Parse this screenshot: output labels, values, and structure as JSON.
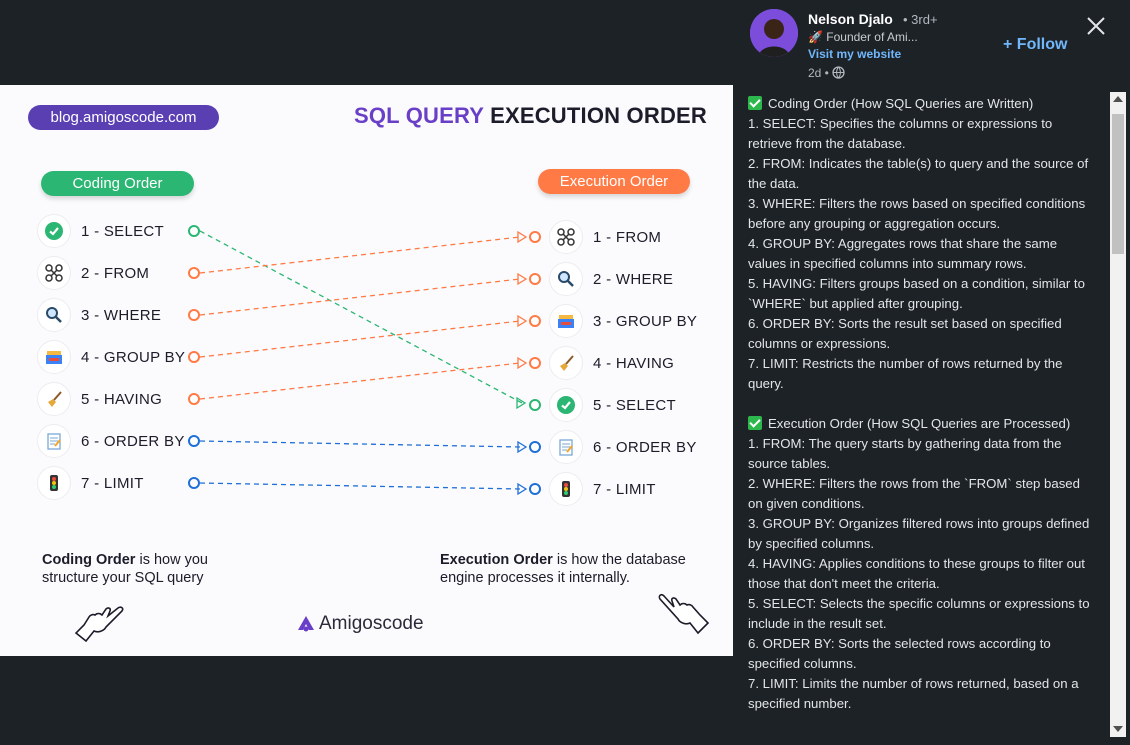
{
  "image": {
    "blog_url": "blog.amigoscode.com",
    "title_part1": "SQL QUERY",
    "title_part2": "EXECUTION ORDER",
    "coding_order_label": "Coding Order",
    "execution_order_label": "Execution Order",
    "coding_items": [
      "1 - SELECT",
      "2 - FROM",
      "3 - WHERE",
      "4 - GROUP BY",
      "5 - HAVING",
      "6 - ORDER BY",
      "7 - LIMIT"
    ],
    "execution_items": [
      "1 - FROM",
      "2 - WHERE",
      "3 - GROUP BY",
      "4 - HAVING",
      "5 - SELECT",
      "6 - ORDER BY",
      "7 - LIMIT"
    ],
    "bottom_left_bold": "Coding Order",
    "bottom_left_rest": " is how you",
    "bottom_left_line2": "structure your SQL query",
    "bottom_right_bold": "Execution Order",
    "bottom_right_rest": " is how the database",
    "bottom_right_line2": "engine processes it internally.",
    "brand": "Amigoscode",
    "colors": {
      "green": "#2bb673",
      "orange": "#ff7a45",
      "blue": "#1f6fd8",
      "purple": "#6a3fc8"
    }
  },
  "author": {
    "name": "Nelson Djalo",
    "degree": "• 3rd+",
    "headline": "🚀 Founder of Ami...",
    "website": "Visit my website",
    "time": "2d •"
  },
  "follow_label": "+ Follow",
  "post": {
    "coding_header": "Coding Order (How SQL Queries are Written)",
    "coding_lines": [
      "1. SELECT: Specifies the columns or expressions to retrieve from the database.",
      "2. FROM: Indicates the table(s) to query and the source of the data.",
      "3. WHERE: Filters the rows based on specified conditions before any grouping or aggregation occurs.",
      "4. GROUP BY: Aggregates rows that share the same values in specified columns into summary rows.",
      "5. HAVING: Filters groups based on a condition, similar to `WHERE` but applied after grouping.",
      "6. ORDER BY: Sorts the result set based on specified columns or expressions.",
      "7. LIMIT: Restricts the number of rows returned by the query."
    ],
    "exec_header": "Execution Order (How SQL Queries are Processed)",
    "exec_lines": [
      "1. FROM: The query starts by gathering data from the source tables.",
      "2. WHERE: Filters the rows from the `FROM` step based on given conditions.",
      "3. GROUP BY: Organizes filtered rows into groups defined by specified columns.",
      "4. HAVING: Applies conditions to these groups to filter out those that don't meet the criteria.",
      "5. SELECT: Selects the specific columns or expressions to include in the result set.",
      "6. ORDER BY: Sorts the selected rows according to specified columns.",
      "7. LIMIT: Limits the number of rows returned, based on a specified number."
    ]
  }
}
